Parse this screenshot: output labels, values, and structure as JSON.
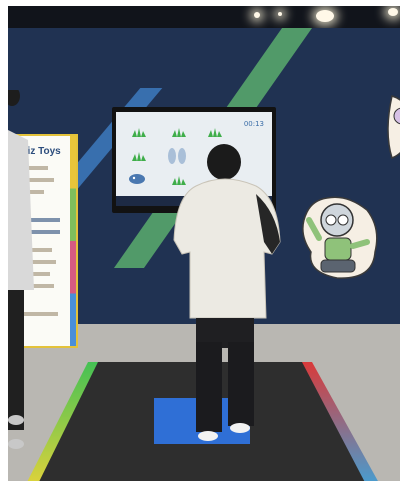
{
  "scene": {
    "description_labels": {
      "screen_timer": "00:13",
      "sign_title": "Whiz Toys"
    },
    "icons": [
      "ceiling-light-icon",
      "grass-icon",
      "footprint-icon",
      "robot-icon"
    ]
  }
}
